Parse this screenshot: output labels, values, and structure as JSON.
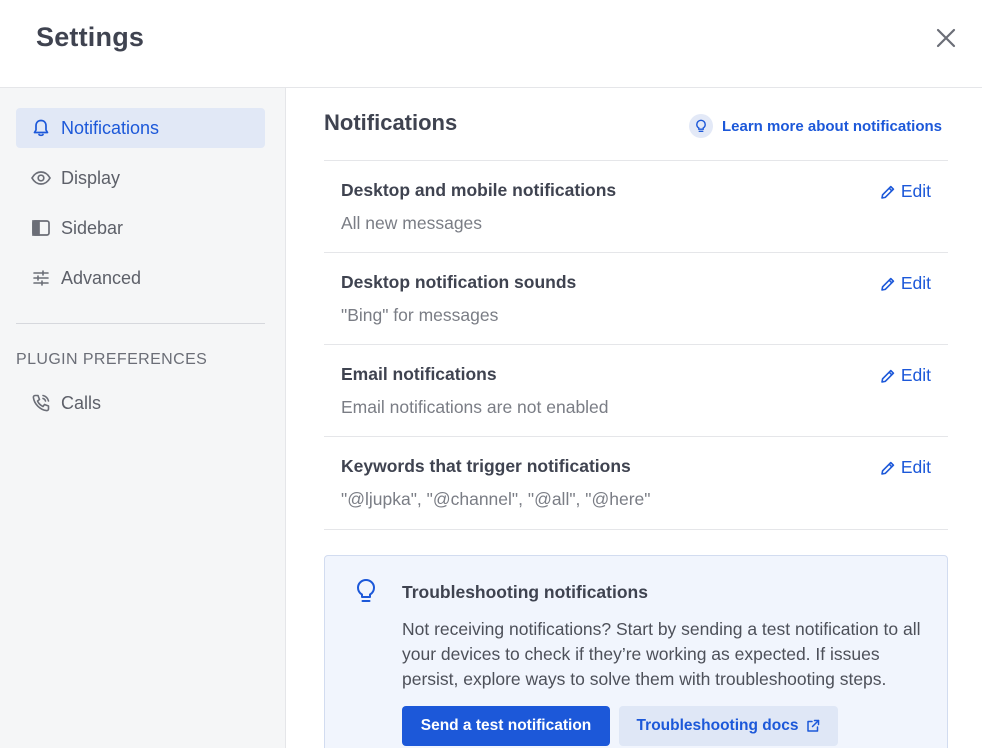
{
  "header": {
    "title": "Settings"
  },
  "sidebar": {
    "items": [
      {
        "label": "Notifications",
        "icon": "bell-icon"
      },
      {
        "label": "Display",
        "icon": "eye-icon"
      },
      {
        "label": "Sidebar",
        "icon": "sidebar-panel-icon"
      },
      {
        "label": "Advanced",
        "icon": "sliders-icon"
      }
    ],
    "section_label": "PLUGIN PREFERENCES",
    "plugin_items": [
      {
        "label": "Calls",
        "icon": "phone-icon"
      }
    ]
  },
  "main": {
    "title": "Notifications",
    "learn_more": "Learn more about notifications",
    "edit_label": "Edit",
    "rows": [
      {
        "title": "Desktop and mobile notifications",
        "desc": "All new messages"
      },
      {
        "title": "Desktop notification sounds",
        "desc": "\"Bing\" for messages"
      },
      {
        "title": "Email notifications",
        "desc": "Email notifications are not enabled"
      },
      {
        "title": "Keywords that trigger notifications",
        "desc": "\"@ljupka\", \"@channel\", \"@all\", \"@here\""
      }
    ],
    "troubleshoot": {
      "title": "Troubleshooting notifications",
      "body": "Not receiving notifications? Start by sending a test notification to all your devices to check if they’re working as expected. If issues persist, explore ways to solve them with troubleshooting steps.",
      "primary_button": "Send a test notification",
      "secondary_button": "Troubleshooting docs"
    }
  },
  "colors": {
    "accent": "#1c58d9",
    "sidebar_bg": "#f5f6f7",
    "active_bg": "#e1e8f6",
    "tip_bg": "#f1f5fd"
  }
}
